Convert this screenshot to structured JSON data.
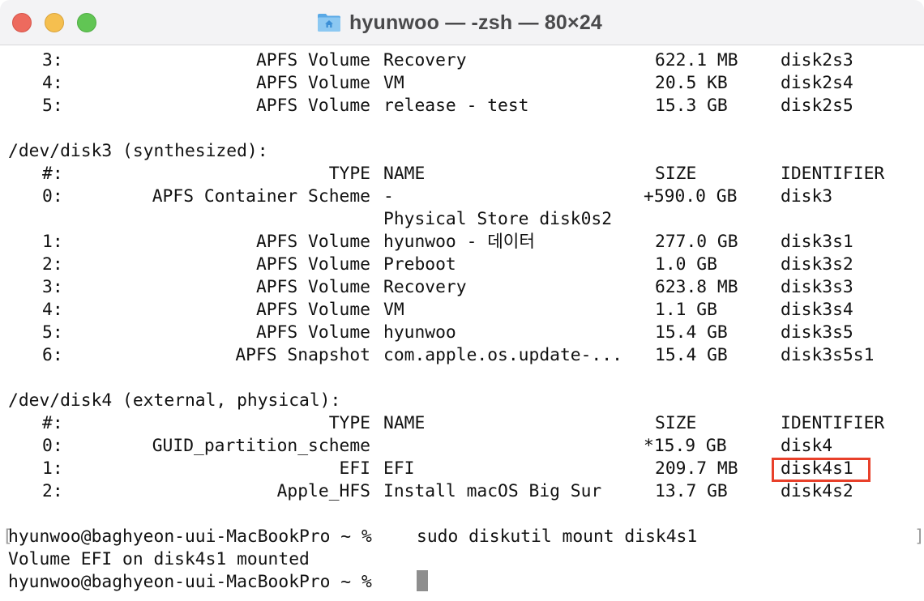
{
  "window": {
    "title": "hyunwoo — -zsh — 80×24",
    "title_icon": "home-folder-icon",
    "controls": [
      "close",
      "minimize",
      "maximize"
    ]
  },
  "terminal": {
    "disk2_tail": [
      {
        "num": "3:",
        "type": "APFS Volume",
        "name": "Recovery",
        "size": "622.1 MB",
        "id": "disk2s3"
      },
      {
        "num": "4:",
        "type": "APFS Volume",
        "name": "VM",
        "size": "20.5 KB",
        "id": "disk2s4"
      },
      {
        "num": "5:",
        "type": "APFS Volume",
        "name": "release - test",
        "size": "15.3 GB",
        "id": "disk2s5"
      }
    ],
    "disk3": {
      "header": "/dev/disk3 (synthesized):",
      "columns": {
        "num": "#:",
        "type": "TYPE",
        "name": "NAME",
        "size": "SIZE",
        "id": "IDENTIFIER"
      },
      "rows": [
        {
          "num": "0:",
          "type": "APFS Container Scheme",
          "name": "-",
          "size": "+590.0 GB",
          "id": "disk3"
        },
        {
          "num": "",
          "type": "",
          "name": "Physical Store disk0s2",
          "size": "",
          "id": ""
        },
        {
          "num": "1:",
          "type": "APFS Volume",
          "name": "hyunwoo - 데이터",
          "size": "277.0 GB",
          "id": "disk3s1"
        },
        {
          "num": "2:",
          "type": "APFS Volume",
          "name": "Preboot",
          "size": "1.0 GB",
          "id": "disk3s2"
        },
        {
          "num": "3:",
          "type": "APFS Volume",
          "name": "Recovery",
          "size": "623.8 MB",
          "id": "disk3s3"
        },
        {
          "num": "4:",
          "type": "APFS Volume",
          "name": "VM",
          "size": "1.1 GB",
          "id": "disk3s4"
        },
        {
          "num": "5:",
          "type": "APFS Volume",
          "name": "hyunwoo",
          "size": "15.4 GB",
          "id": "disk3s5"
        },
        {
          "num": "6:",
          "type": "APFS Snapshot",
          "name": "com.apple.os.update-...",
          "size": "15.4 GB",
          "id": "disk3s5s1"
        }
      ]
    },
    "disk4": {
      "header": "/dev/disk4 (external, physical):",
      "columns": {
        "num": "#:",
        "type": "TYPE",
        "name": "NAME",
        "size": "SIZE",
        "id": "IDENTIFIER"
      },
      "rows": [
        {
          "num": "0:",
          "type": "GUID_partition_scheme",
          "name": "",
          "size": "*15.9 GB",
          "id": "disk4"
        },
        {
          "num": "1:",
          "type": "EFI",
          "name": "EFI",
          "size": "209.7 MB",
          "id": "disk4s1"
        },
        {
          "num": "2:",
          "type": "Apple_HFS",
          "name": "Install macOS Big Sur",
          "size": "13.7 GB",
          "id": "disk4s2"
        }
      ]
    },
    "command_line": {
      "prompt": "hyunwoo@baghyeon-uui-MacBookPro ~ %",
      "command": "sudo diskutil mount disk4s1"
    },
    "output": "Volume EFI on disk4s1 mounted",
    "current_prompt": "hyunwoo@baghyeon-uui-MacBookPro ~ %",
    "highlighted_identifier": "disk4s1",
    "highlight_color": "#e8402a"
  }
}
